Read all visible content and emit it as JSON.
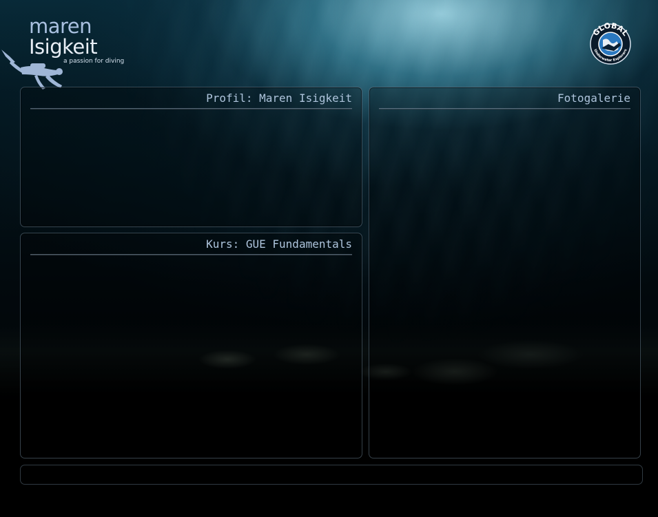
{
  "logo": {
    "line1": "maren",
    "line2": "Isigkeit",
    "tagline": "a passion for diving"
  },
  "badge": {
    "top_text": "GLOBAL",
    "bottom_text": "Underwater Explorers",
    "icon": "gue-globe-diver-icon"
  },
  "panels": {
    "profile": {
      "title": "Profil: Maren Isigkeit"
    },
    "course": {
      "title": "Kurs: GUE Fundamentals"
    },
    "gallery": {
      "title": "Fotogalerie"
    }
  },
  "footer": {
    "text": ""
  },
  "colors": {
    "title_text": "#aec4dc",
    "logo_accent": "#a9c0e0",
    "panel_border": "#78919f",
    "badge_blue": "#1f6fb3"
  }
}
